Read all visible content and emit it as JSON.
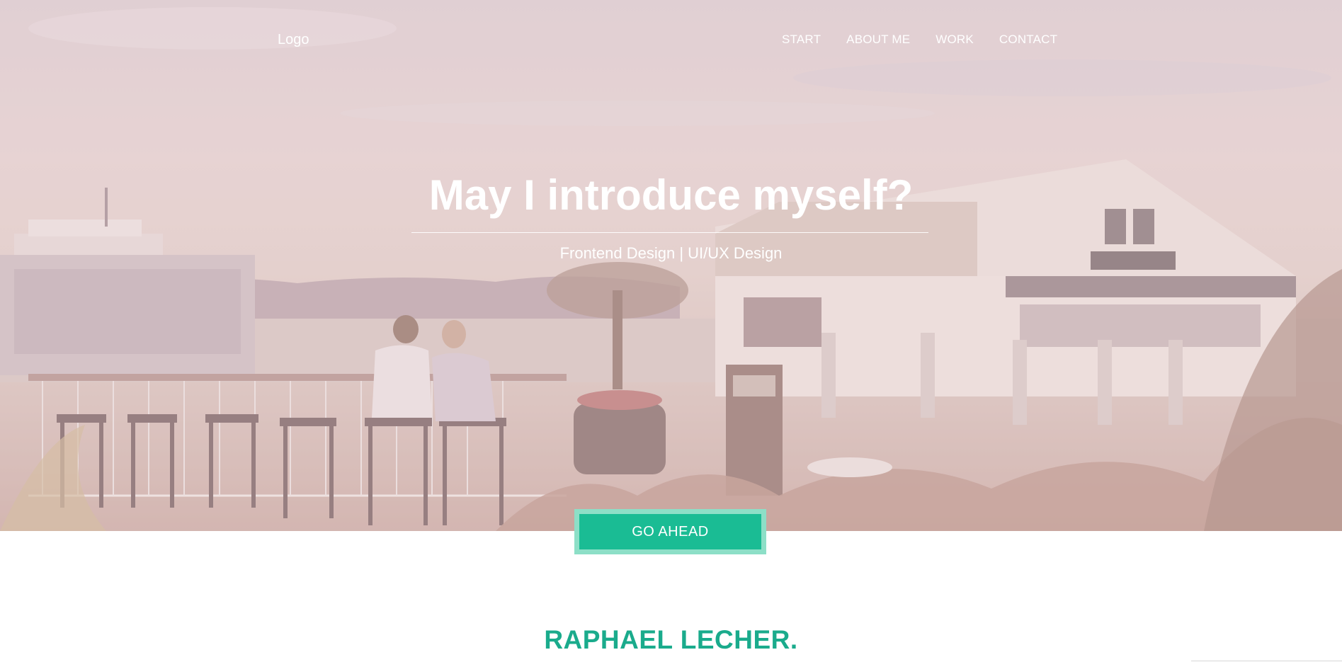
{
  "nav": {
    "logo": "Logo",
    "items": [
      "START",
      "ABOUT ME",
      "WORK",
      "CONTACT"
    ]
  },
  "hero": {
    "headline": "May I introduce myself?",
    "subtitle": "Frontend Design | UI/UX Design",
    "cta_label": "GO AHEAD"
  },
  "about": {
    "name": "RAPHAEL LECHER."
  },
  "colors": {
    "accent": "#1abc94",
    "accent_light": "#8ddfc7",
    "name_color": "#1aab8c",
    "overlay": "#e6cfcf"
  }
}
